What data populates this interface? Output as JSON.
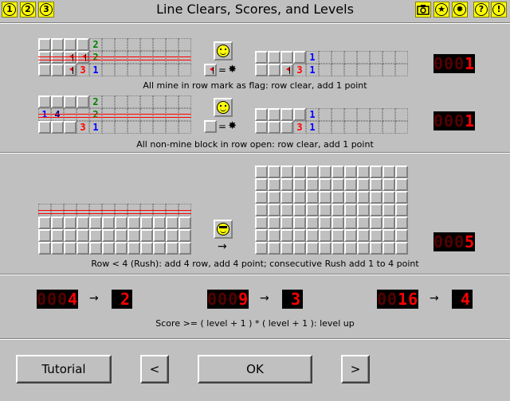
{
  "header": {
    "title": "Line Clears, Scores, and Levels",
    "left_buttons": [
      "1",
      "2",
      "3"
    ],
    "right_buttons": [
      {
        "icon": "camera-icon"
      },
      {
        "icon": "star-icon"
      },
      {
        "icon": "gear-icon"
      },
      {
        "icon": "help-icon",
        "label": "?"
      },
      {
        "icon": "alert-icon",
        "label": "!"
      }
    ]
  },
  "sections": {
    "flag_rule": {
      "caption": "All mine in row mark as flag: row clear, add 1 point",
      "equation": {
        "equals": "=",
        "mine": "✸"
      },
      "score": {
        "dim": "000",
        "value": "1"
      }
    },
    "open_rule": {
      "caption": "All non-mine block in row open: row clear, add 1 point",
      "equation": {
        "equals": "=",
        "mine": "✸"
      },
      "score": {
        "dim": "000",
        "value": "1"
      }
    },
    "rush_rule": {
      "caption": "Row < 4 (Rush): add 4 row, add 4 point; consecutive Rush add 1 to 4 point",
      "arrow": "→",
      "score": {
        "dim": "000",
        "value": "5"
      }
    },
    "level_rule": {
      "caption": "Score >= ( level + 1 ) * ( level + 1 ): level up",
      "examples": [
        {
          "score_dim": "000",
          "score": "4",
          "arrow": "→",
          "level": "2"
        },
        {
          "score_dim": "000",
          "score": "9",
          "arrow": "→",
          "level": "3"
        },
        {
          "score_dim": "00",
          "score": "16",
          "arrow": "→",
          "level": "4"
        }
      ]
    }
  },
  "footer": {
    "tutorial": "Tutorial",
    "prev": "<",
    "ok": "OK",
    "next": ">"
  }
}
